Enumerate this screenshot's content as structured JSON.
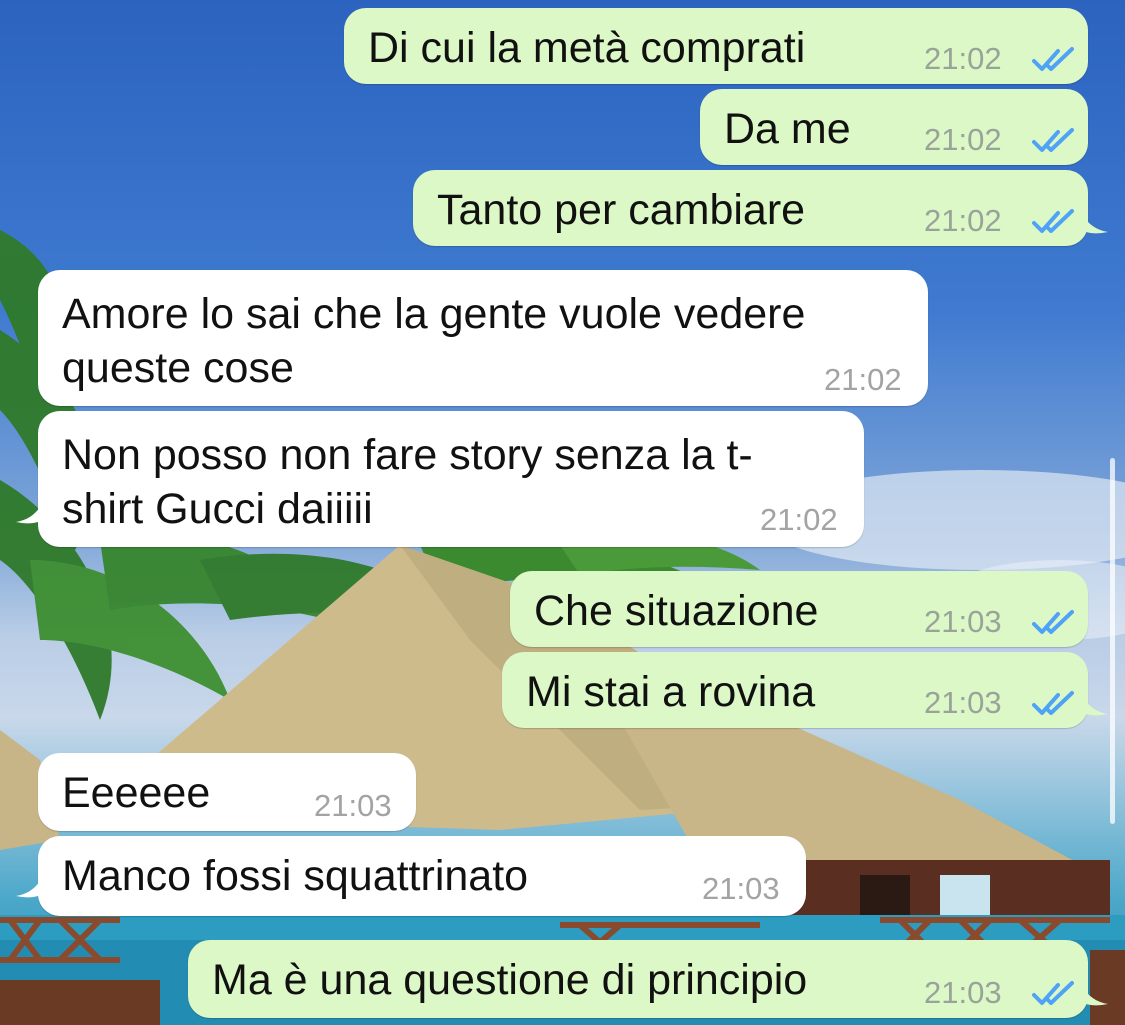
{
  "messages": [
    {
      "text": "Di cui la metà comprati",
      "time": "21:02",
      "direction": "out",
      "status": "read"
    },
    {
      "text": "Da me",
      "time": "21:02",
      "direction": "out",
      "status": "read"
    },
    {
      "text": "Tanto per cambiare",
      "time": "21:02",
      "direction": "out",
      "status": "read"
    },
    {
      "line1": "Amore lo sai che la gente vuole vedere",
      "line2": "queste cose",
      "time": "21:02",
      "direction": "in"
    },
    {
      "line1": "Non posso non fare story senza la t-",
      "line2": "shirt Gucci daiiiii",
      "time": "21:02",
      "direction": "in"
    },
    {
      "text": "Che situazione",
      "time": "21:03",
      "direction": "out",
      "status": "read"
    },
    {
      "text": "Mi stai a rovina",
      "time": "21:03",
      "direction": "out",
      "status": "read"
    },
    {
      "text": "Eeeeee",
      "time": "21:03",
      "direction": "in"
    },
    {
      "text": "Manco fossi squattrinato",
      "time": "21:03",
      "direction": "in"
    },
    {
      "text": "Ma è una questione di principio",
      "time": "21:03",
      "direction": "out",
      "status": "read"
    }
  ],
  "colors": {
    "outgoing_bubble": "#dcf8c6",
    "incoming_bubble": "#ffffff",
    "read_ticks": "#4fa3f7",
    "timestamp": "#9aa39a"
  },
  "icons": {
    "read_receipt": "double-check-icon",
    "wallpaper": "tropical-bungalow-wallpaper"
  }
}
